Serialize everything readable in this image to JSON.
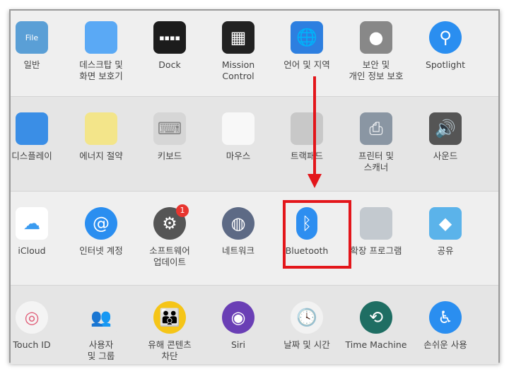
{
  "rows": [
    {
      "items": [
        {
          "label": "일반",
          "icon": "general-icon",
          "color": "#5a9fd6",
          "glyph": "File"
        },
        {
          "label": "데스크탑 및\n화면 보호기",
          "icon": "desktop-screensaver-icon",
          "color": "#5aa9f5",
          "glyph": ""
        },
        {
          "label": "Dock",
          "icon": "dock-icon",
          "color": "#1c1c1c",
          "glyph": "▪▪▪▪"
        },
        {
          "label": "Mission\nControl",
          "icon": "mission-control-icon",
          "color": "#222",
          "glyph": "▦"
        },
        {
          "label": "언어 및 지역",
          "icon": "language-region-flag-icon",
          "color": "#2d7fe0",
          "glyph": "🌐"
        },
        {
          "label": "보안 및\n개인 정보 보호",
          "icon": "security-house-icon",
          "color": "#888",
          "glyph": "●"
        },
        {
          "label": "Spotlight",
          "icon": "spotlight-magnifier-icon",
          "color": "#2a8ef0",
          "glyph": "⚲"
        }
      ]
    },
    {
      "items": [
        {
          "label": "디스플레이",
          "icon": "display-monitor-icon",
          "color": "#3a8ee6",
          "glyph": ""
        },
        {
          "label": "에너지 절약",
          "icon": "energy-bulb-icon",
          "color": "#f3e58a",
          "glyph": ""
        },
        {
          "label": "키보드",
          "icon": "keyboard-icon",
          "color": "#d6d6d6",
          "glyph": "⌨"
        },
        {
          "label": "마우스",
          "icon": "mouse-icon",
          "color": "#f8f8f8",
          "glyph": ""
        },
        {
          "label": "트랙패드",
          "icon": "trackpad-icon",
          "color": "#c8c8c8",
          "glyph": ""
        },
        {
          "label": "프린터 및\n스캐너",
          "icon": "printer-icon",
          "color": "#8a96a3",
          "glyph": "⎙"
        },
        {
          "label": "사운드",
          "icon": "speaker-icon",
          "color": "#555",
          "glyph": "🔊"
        }
      ]
    },
    {
      "items": [
        {
          "label": "iCloud",
          "icon": "icloud-icon",
          "color": "#ffffff",
          "glyph": "☁"
        },
        {
          "label": "인터넷 계정",
          "icon": "internet-accounts-at-icon",
          "color": "#2a8ef0",
          "glyph": "@"
        },
        {
          "label": "소프트웨어\n업데이트",
          "icon": "software-update-gear-icon",
          "color": "#555",
          "glyph": "⚙",
          "badge": "1"
        },
        {
          "label": "네트워크",
          "icon": "network-globe-icon",
          "color": "#5d6a85",
          "glyph": "◍"
        },
        {
          "label": "Bluetooth",
          "icon": "bluetooth-icon",
          "color": "#2d8ef0",
          "glyph": "ᛒ"
        },
        {
          "label": "확장 프로그램",
          "icon": "extensions-puzzle-icon",
          "color": "#c3c9cf",
          "glyph": ""
        },
        {
          "label": "공유",
          "icon": "sharing-folder-icon",
          "color": "#5bb3ea",
          "glyph": "◆"
        }
      ]
    },
    {
      "items": [
        {
          "label": "Touch ID",
          "icon": "touch-id-fingerprint-icon",
          "color": "#f4f4f4",
          "glyph": "◎"
        },
        {
          "label": "사용자\n및 그룹",
          "icon": "users-groups-icon",
          "color": "#e5e5e5",
          "glyph": "👥"
        },
        {
          "label": "유해 콘텐츠\n차단",
          "icon": "parental-controls-icon",
          "color": "#f5c518",
          "glyph": "👪"
        },
        {
          "label": "Siri",
          "icon": "siri-icon",
          "color": "#6a3fb5",
          "glyph": "◉"
        },
        {
          "label": "날짜 및 시간",
          "icon": "date-time-clock-icon",
          "color": "#f2f2f2",
          "glyph": "🕓"
        },
        {
          "label": "Time Machine",
          "icon": "time-machine-icon",
          "color": "#1f6e63",
          "glyph": "⟲"
        },
        {
          "label": "손쉬운 사용",
          "icon": "accessibility-icon",
          "color": "#2a8ef0",
          "glyph": "♿"
        }
      ]
    }
  ],
  "annotation": {
    "arrow_color": "#e3161b",
    "highlight": "Bluetooth"
  }
}
